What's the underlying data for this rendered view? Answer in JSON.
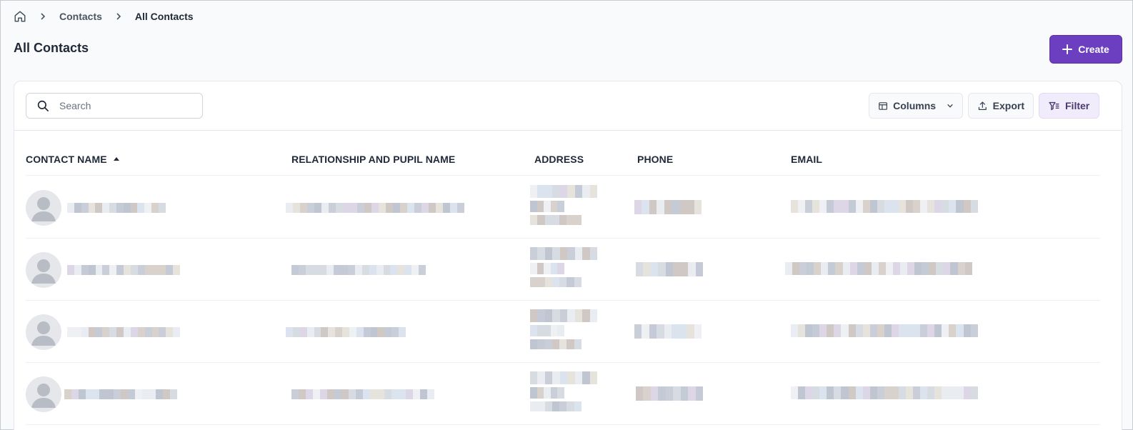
{
  "breadcrumb": {
    "home_icon": "home-icon",
    "items": [
      "Contacts",
      "All Contacts"
    ]
  },
  "page": {
    "title": "All Contacts",
    "create_label": "Create"
  },
  "toolbar": {
    "search_placeholder": "Search",
    "columns_label": "Columns",
    "export_label": "Export",
    "filter_label": "Filter"
  },
  "table": {
    "columns": [
      "CONTACT NAME",
      "RELATIONSHIP AND PUPIL NAME",
      "ADDRESS",
      "PHONE",
      "EMAIL"
    ],
    "sort": {
      "column": "CONTACT NAME",
      "direction": "ascending"
    },
    "row_count": 4
  },
  "colors": {
    "accent": "#6b3fc0",
    "filter_bg": "#f1ecfb"
  }
}
